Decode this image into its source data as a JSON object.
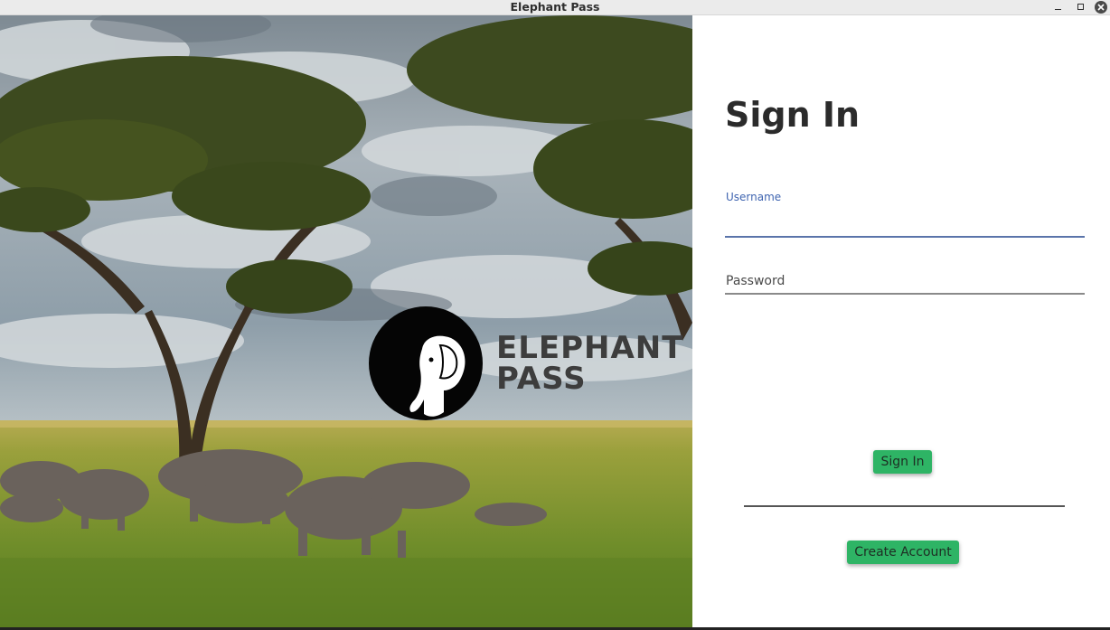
{
  "window": {
    "title": "Elephant Pass"
  },
  "hero": {
    "brand_line1": "ELEPHANT",
    "brand_line2": "PASS"
  },
  "signin": {
    "heading": "Sign In",
    "username_label": "Username",
    "username_value": "",
    "password_placeholder": "Password",
    "password_value": "",
    "signin_button": "Sign In",
    "create_account_button": "Create Account"
  },
  "colors": {
    "accent_button": "#2eb465",
    "focused_field": "#3f64b0",
    "titlebar": "#ebebeb"
  },
  "icons": [
    "minimize-icon",
    "maximize-icon",
    "close-icon",
    "elephant-logo-icon"
  ]
}
